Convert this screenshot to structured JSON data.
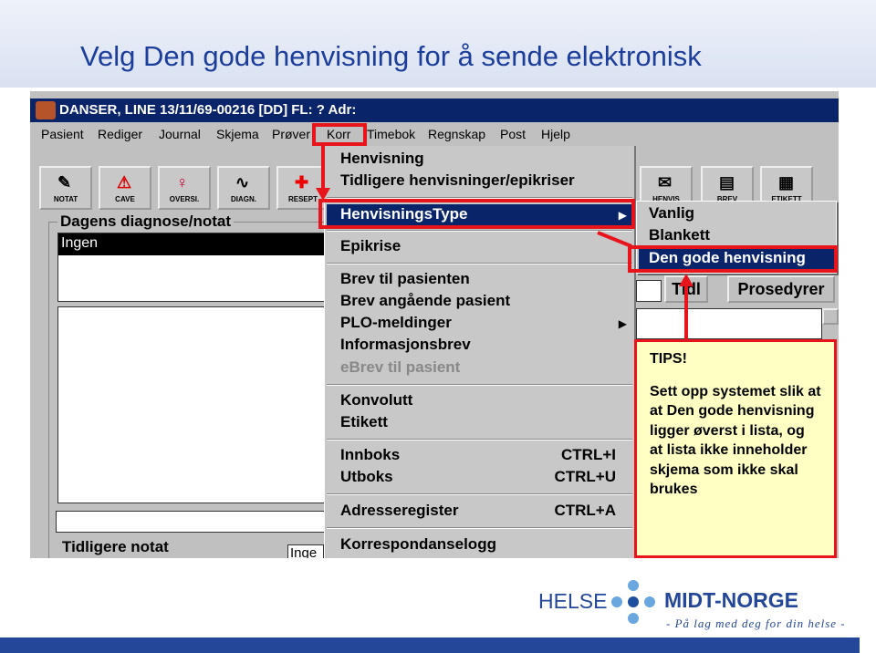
{
  "slide": {
    "title": "Velg Den gode henvisning for å sende elektronisk"
  },
  "app": {
    "title": "DANSER, LINE 13/11/69-00216 [DD] FL: ? Adr:",
    "menubar": [
      "Pasient",
      "Rediger",
      "Journal",
      "Skjema",
      "Prøver",
      "Korr",
      "Timebok",
      "Regnskap",
      "Post",
      "Hjelp"
    ],
    "toolbar_left": [
      "NOTAT",
      "CAVE",
      "OVERSI.",
      "DIAGN.",
      "RESEPT"
    ],
    "toolbar_right": [
      "HENVIS",
      "BREV",
      "ETIKETT"
    ],
    "diagnosis_group": "Dagens diagnose/notat",
    "diagnosis_selected": "Ingen",
    "previous_notes": "Tidligere notat",
    "previous_notes_value": "Inge",
    "buttons": {
      "tidl": "Tidl",
      "prosedyrer": "Prosedyrer"
    }
  },
  "korr_menu": {
    "items": [
      {
        "label": "Henvisning"
      },
      {
        "label": "Tidligere henvisninger/epikriser"
      },
      {
        "label": "HenvisningsType",
        "submenu": true,
        "highlighted": true
      },
      {
        "label": "Epikrise"
      },
      {
        "label": "Brev til pasienten"
      },
      {
        "label": "Brev angående pasient"
      },
      {
        "label": "PLO-meldinger",
        "submenu": true
      },
      {
        "label": "Informasjonsbrev"
      },
      {
        "label": "eBrev til pasient",
        "disabled": true
      },
      {
        "label": "Konvolutt"
      },
      {
        "label": "Etikett"
      },
      {
        "label": "Innboks",
        "shortcut": "CTRL+I"
      },
      {
        "label": "Utboks",
        "shortcut": "CTRL+U"
      },
      {
        "label": "Adresseregister",
        "shortcut": "CTRL+A"
      },
      {
        "label": "Korrespondanselogg"
      }
    ]
  },
  "submenu": {
    "items": [
      "Vanlig",
      "Blankett",
      "Den gode henvisning"
    ],
    "selected": "Den gode henvisning"
  },
  "tips": {
    "heading": "TIPS!",
    "text": "Sett opp systemet slik at at Den gode henvisning ligger øverst i lista, og at lista ikke inneholder skjema som ikke skal brukes"
  },
  "logo": {
    "left": "HELSE",
    "right": "MIDT-NORGE",
    "tagline": "- På lag med deg for din helse -"
  },
  "colors": {
    "title": "#1b3d9c",
    "highlight": "#0a246a",
    "annotation": "#e8141b",
    "tips_bg": "#ffffc4",
    "footer": "#24479a"
  }
}
